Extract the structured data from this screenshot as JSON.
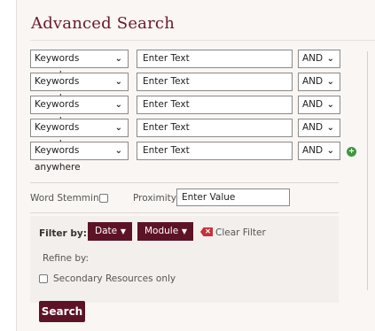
{
  "title": "Advanced Search",
  "rows": [
    {
      "field": "Keywords anywhere",
      "text": "Enter Text",
      "operator": "AND"
    },
    {
      "field": "Keywords anywhere",
      "text": "Enter Text",
      "operator": "AND"
    },
    {
      "field": "Keywords anywhere",
      "text": "Enter Text",
      "operator": "AND"
    },
    {
      "field": "Keywords anywhere",
      "text": "Enter Text",
      "operator": "AND"
    },
    {
      "field": "Keywords anywhere",
      "text": "Enter Text",
      "operator": "AND"
    }
  ],
  "options": {
    "word_stemming_label": "Word Stemming",
    "proximity_label": "Proximity",
    "proximity_placeholder": "Enter Value"
  },
  "filter": {
    "label": "Filter by:",
    "date_label": "Date",
    "module_label": "Module",
    "clear_label": "Clear Filter",
    "refine_label": "Refine by:",
    "secondary_label": "Secondary Resources only"
  },
  "search_button": "Search",
  "colors": {
    "brand": "#5d1326",
    "title": "#6b1a2a",
    "add": "#3c9a3c",
    "clear": "#c8303a"
  }
}
